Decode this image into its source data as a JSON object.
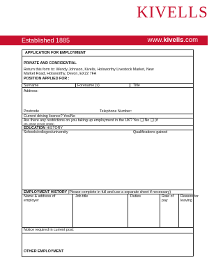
{
  "header": {
    "logo_text": "KIVELLS",
    "established": "Established 1885",
    "website_prefix": "www.",
    "website_name": "kivells",
    "website_suffix": ".com",
    "brand_color": "#c8102e"
  },
  "form": {
    "title": "APPLICATION FOR EMPLOYMENT",
    "confidential": "PRIVATE AND CONFIDENTIAL",
    "return_line1": "Return this form to: Wendy Johnson, Kivells, Holsworthy Livestock Market, New",
    "return_line2": "Market Road, Holsworthy, Devon, EX22 7FA",
    "position_label": "POSITION APPLIED FOR :",
    "surname_label": "Surname",
    "forenames_label": "Forename (s)",
    "title_label": "Title",
    "address_label": "Address:",
    "postcode_label": "Postcode",
    "telephone_label": "Telephone Number:",
    "driving_label": "Current driving licence? Yes/No",
    "restrictions_label": "Are there any restrictions on you taking up employment in the UK? Yes ❑ No ❑ (if",
    "restrictions_note": "yes, please provide details)",
    "education_heading": "EDUCATION",
    "education_history": " HISTORY",
    "schools_label": "Schools/colleges/university",
    "qualifications_label": "Qualifications gained",
    "employment_heading": "EMPLOYMENT HISTORY",
    "employment_note": " (Please complete in full and use a separate sheet if necessary)",
    "emp_col_name": "Name & address of",
    "emp_col_name2": "employer",
    "emp_col_job": "Job title",
    "emp_col_duties": "Duties",
    "emp_col_rate": "Rate of",
    "emp_col_rate2": "pay",
    "emp_col_reason": "Reason for",
    "emp_col_reason2": "leaving",
    "notice_label": "Notice required in current post:",
    "other_employment": "OTHER EMPLOYMENT"
  }
}
